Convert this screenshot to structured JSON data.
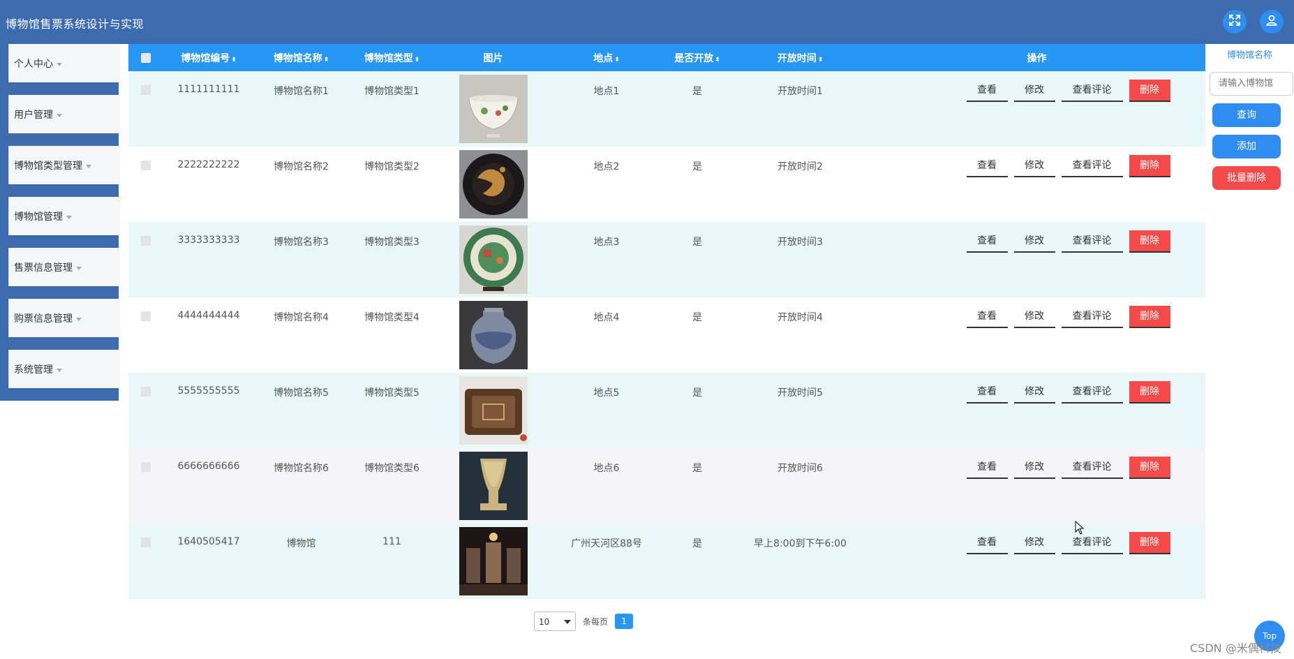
{
  "header": {
    "title": "博物馆售票系统设计与实现",
    "fullscreen_icon": "fullscreen-icon",
    "user_icon": "user-icon",
    "accent_color": "#3d6bb0"
  },
  "sidebar": {
    "items": [
      {
        "label": "个人中心"
      },
      {
        "label": "用户管理"
      },
      {
        "label": "博物馆类型管理"
      },
      {
        "label": "博物馆管理"
      },
      {
        "label": "售票信息管理"
      },
      {
        "label": "购票信息管理"
      },
      {
        "label": "系统管理"
      }
    ]
  },
  "table": {
    "columns": [
      "博物馆编号",
      "博物馆名称",
      "博物馆类型",
      "图片",
      "地点",
      "是否开放",
      "开放时间",
      "操作"
    ],
    "header_color": "#2896f3",
    "actions": {
      "view": "查看",
      "edit": "修改",
      "comments": "查看评论",
      "delete": "删除"
    },
    "rows": [
      {
        "id": "1111111111",
        "name": "博物馆名称1",
        "type": "博物馆类型1",
        "location": "地点1",
        "open": "是",
        "hours": "开放时间1"
      },
      {
        "id": "2222222222",
        "name": "博物馆名称2",
        "type": "博物馆类型2",
        "location": "地点2",
        "open": "是",
        "hours": "开放时间2"
      },
      {
        "id": "3333333333",
        "name": "博物馆名称3",
        "type": "博物馆类型3",
        "location": "地点3",
        "open": "是",
        "hours": "开放时间3"
      },
      {
        "id": "4444444444",
        "name": "博物馆名称4",
        "type": "博物馆类型4",
        "location": "地点4",
        "open": "是",
        "hours": "开放时间4"
      },
      {
        "id": "5555555555",
        "name": "博物馆名称5",
        "type": "博物馆类型5",
        "location": "地点5",
        "open": "是",
        "hours": "开放时间5"
      },
      {
        "id": "6666666666",
        "name": "博物馆名称6",
        "type": "博物馆类型6",
        "location": "地点6",
        "open": "是",
        "hours": "开放时间6"
      },
      {
        "id": "1640505417",
        "name": "博物馆",
        "type": "111",
        "location": "广州天河区88号",
        "open": "是",
        "hours": "早上8:00到下午6:00"
      }
    ]
  },
  "search_panel": {
    "label": "博物馆名称",
    "input_placeholder": "请输入博物馆",
    "query_button": "查询",
    "add_button": "添加",
    "batch_delete_button": "批量删除",
    "primary_color": "#2f8cf0",
    "danger_color": "#f44a4a"
  },
  "pagination": {
    "page_size": "10",
    "per_page_label": "条每页",
    "current_page": "1"
  },
  "back_to_top": "Top",
  "watermark": "CSDN @米偶科技"
}
